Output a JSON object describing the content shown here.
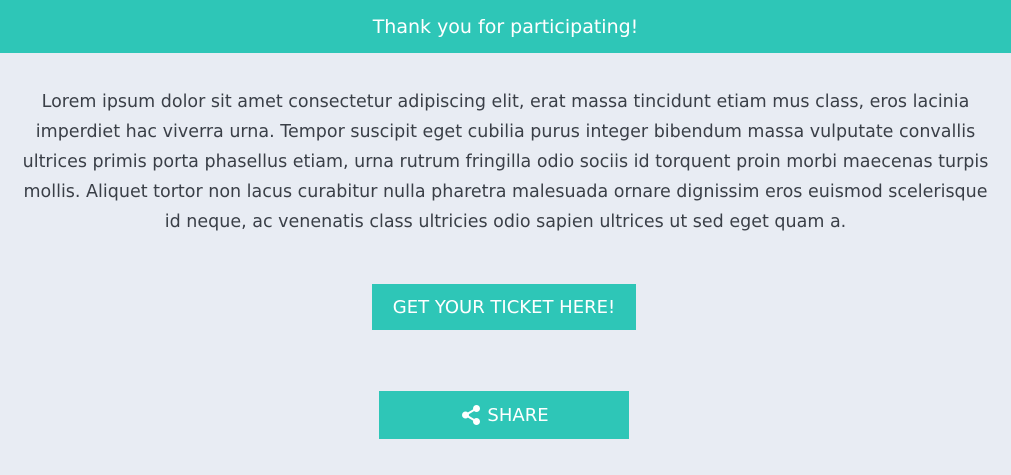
{
  "header": {
    "title": "Thank you for participating!"
  },
  "main": {
    "body_text": "Lorem ipsum dolor sit amet consectetur adipiscing elit, erat massa tincidunt etiam mus class, eros lacinia imperdiet hac viverra urna. Tempor suscipit eget cubilia purus integer bibendum massa vulputate convallis ultrices primis porta phasellus etiam, urna rutrum fringilla odio sociis id torquent proin morbi maecenas turpis mollis. Aliquet tortor non lacus curabitur nulla pharetra malesuada ornare dignissim eros euismod scelerisque id neque, ac venenatis class ultricies odio sapien ultrices ut sed eget quam a.",
    "ticket_button_label": "GET YOUR TICKET HERE!",
    "share_button_label": "SHARE",
    "share_icon": "share-icon"
  },
  "colors": {
    "accent": "#2ec6b7",
    "background": "#e8ecf3",
    "text": "#3a3f47",
    "button_text": "#ffffff"
  }
}
